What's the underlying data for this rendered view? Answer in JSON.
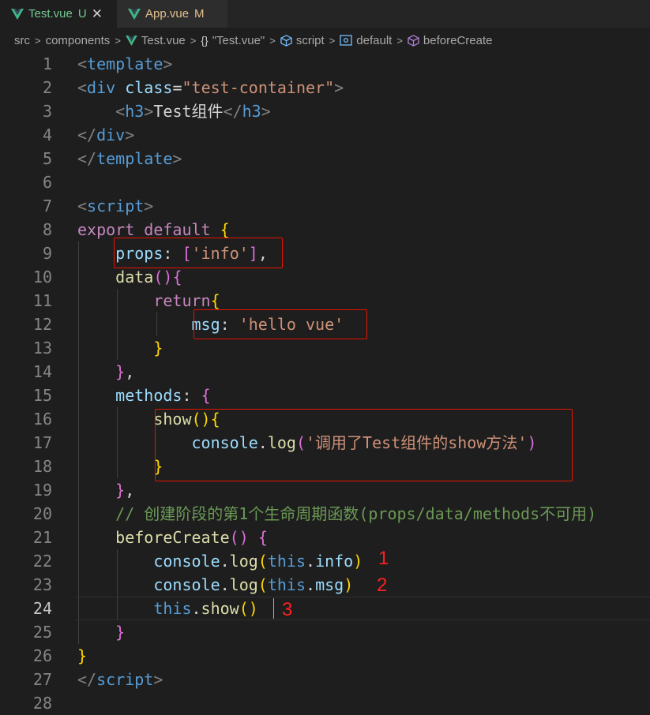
{
  "tabs": [
    {
      "name": "Test.vue",
      "badge": "U",
      "close": "✕"
    },
    {
      "name": "App.vue",
      "badge": "M"
    }
  ],
  "breadcrumb": {
    "src": "src",
    "components": "components",
    "file": "Test.vue",
    "object": "\"Test.vue\"",
    "script": "script",
    "default": "default",
    "hook": "beforeCreate"
  },
  "code": {
    "l1_template": "template",
    "l2_div": "div",
    "l2_class": "class",
    "l2_eq": "=",
    "l2_value": "\"test-container\"",
    "l3_h3": "h3",
    "l3_text": "Test组件",
    "l4_div": "div",
    "l5_template": "template",
    "l7_script": "script",
    "l8_export": "export",
    "l8_default": "default",
    "l9_props": "props",
    "l9_info": "'info'",
    "l10_data": "data",
    "l11_return": "return",
    "l12_msg": "msg",
    "l12_value": "'hello vue'",
    "l15_methods": "methods",
    "l16_show": "show",
    "l17_console": "console",
    "l17_log": "log",
    "l17_str": "'调用了Test组件的show方法'",
    "l20_comment": "// 创建阶段的第1个生命周期函数(props/data/methods不可用)",
    "l21_beforeCreate": "beforeCreate",
    "l22_console": "console",
    "l22_log": "log",
    "l22_this": "this",
    "l22_info": "info",
    "l23_console": "console",
    "l23_log": "log",
    "l23_this": "this",
    "l23_msg": "msg",
    "l24_this": "this",
    "l24_show": "show",
    "l27_script": "script"
  },
  "line_numbers": [
    "1",
    "2",
    "3",
    "4",
    "5",
    "6",
    "7",
    "8",
    "9",
    "10",
    "11",
    "12",
    "13",
    "14",
    "15",
    "16",
    "17",
    "18",
    "19",
    "20",
    "21",
    "22",
    "23",
    "24",
    "25",
    "26",
    "27",
    "28"
  ],
  "annotations": [
    "1",
    "2",
    "3"
  ],
  "colors": {
    "annotation_red": "#e51400",
    "tag": "#569cd6",
    "string": "#ce9178",
    "keyword": "#c586c0",
    "property": "#9cdcfe",
    "function": "#dcdcaa",
    "comment": "#6a9955"
  },
  "icons": [
    "vue-icon",
    "close-icon",
    "chevron-right-icon",
    "braces-icon",
    "cube-icon",
    "field-icon"
  ]
}
